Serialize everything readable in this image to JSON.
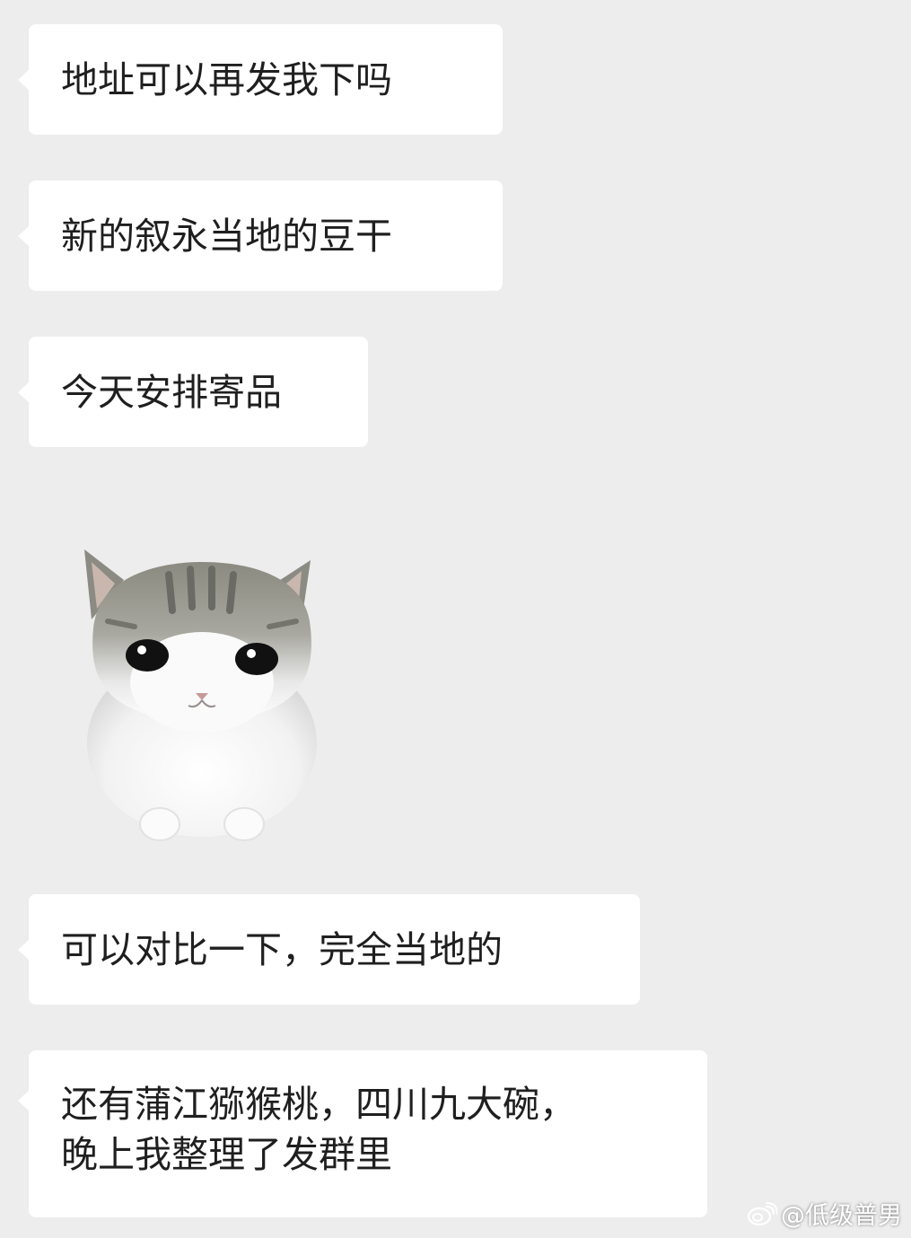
{
  "messages": [
    {
      "text": "地址可以再发我下吗"
    },
    {
      "text": "新的叙永当地的豆干"
    },
    {
      "text": "今天安排寄品"
    },
    {
      "text": "可以对比一下，完全当地的"
    },
    {
      "lines": [
        "还有蒲江猕猴桃，四川九大碗，",
        "晚上我整理了发群里"
      ]
    }
  ],
  "sticker": {
    "icon": "cat-sticker-icon"
  },
  "watermark": {
    "text": "@低级普男",
    "icon": "weibo-icon"
  },
  "colors": {
    "background": "#ededed",
    "bubble": "#ffffff",
    "text": "#1f1f1f"
  }
}
